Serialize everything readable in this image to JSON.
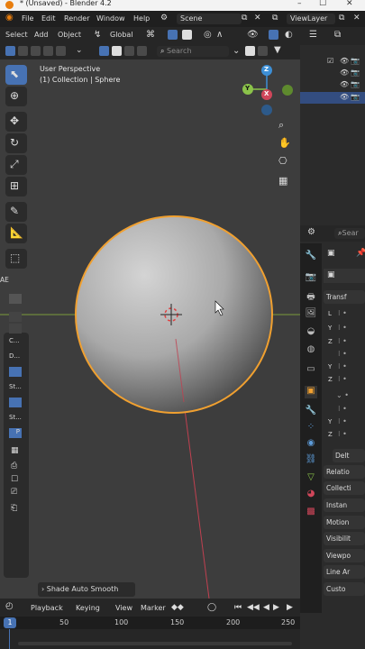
{
  "window": {
    "title": "* (Unsaved) - Blender 4.2",
    "minimize": "–",
    "maximize": "☐",
    "close": "✕"
  },
  "menu": {
    "items": [
      "File",
      "Edit",
      "Render",
      "Window",
      "Help"
    ],
    "scene": "Scene",
    "view_layer": "ViewLayer"
  },
  "header": {
    "select": "Select",
    "add": "Add",
    "object": "Object",
    "orientation": "Global",
    "search_placeholder": "Search"
  },
  "viewport": {
    "view_name": "User Perspective",
    "collection_info": "(1) Collection | Sphere",
    "last_op": "Shade Auto Smooth",
    "panel_tab": "AE"
  },
  "toolbar_labels": {
    "c": "C...",
    "d": "D...",
    "st1": "St...",
    "st2": "St...",
    "p": "P"
  },
  "gizmo": {
    "z": "Z",
    "y": "Y",
    "x": "X"
  },
  "properties": {
    "search_placeholder": "Sear",
    "transform": "Transf",
    "axes": [
      "L",
      "Y",
      "Z",
      "Y",
      "Z",
      "Y",
      "Z"
    ],
    "delta": "Delt",
    "sections": [
      "Relatio",
      "Collecti",
      "Instan",
      "Motion",
      "Visibilit",
      "Viewpo",
      "Line Ar",
      "Custo"
    ]
  },
  "timeline": {
    "playback": "Playback",
    "keying": "Keying",
    "view": "View",
    "marker": "Marker",
    "current_frame": "1",
    "ticks": [
      "50",
      "100",
      "150",
      "200",
      "250"
    ]
  },
  "colors": {
    "accent": "#4772b3",
    "selection_outline": "#f0a030",
    "x_axis": "#d0465a",
    "y_axis": "#8bc34a",
    "z_axis": "#3d8fd6"
  }
}
